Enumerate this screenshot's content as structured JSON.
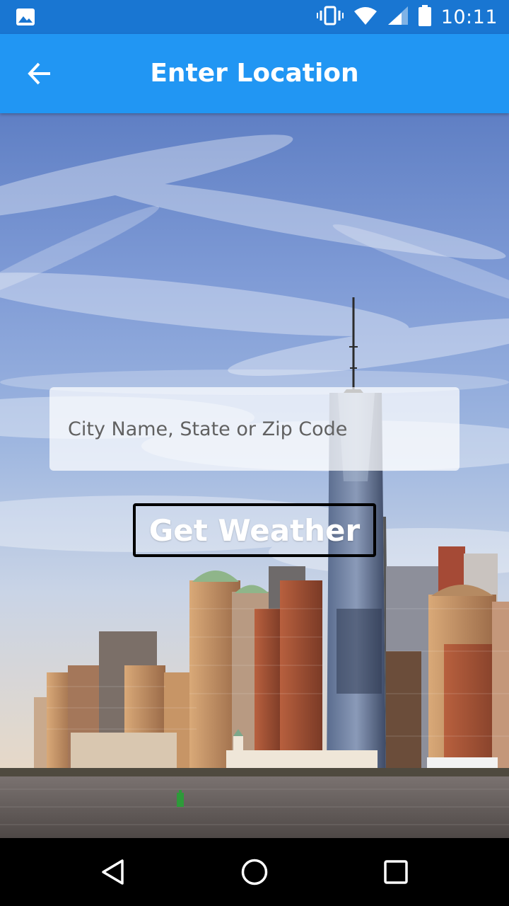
{
  "status_bar": {
    "time": "10:11",
    "icons": [
      "image-notification-icon",
      "vibrate-icon",
      "wifi-icon",
      "cell-signal-icon",
      "battery-icon"
    ]
  },
  "app_bar": {
    "title": "Enter Location",
    "back_icon": "arrow-back-icon",
    "background": "#2196f3",
    "status_background": "#1976d2"
  },
  "search": {
    "placeholder": "City Name, State or Zip Code",
    "value": ""
  },
  "actions": {
    "get_weather_label": "Get Weather"
  },
  "nav_bar": {
    "icons": [
      "back-triangle-icon",
      "home-circle-icon",
      "recents-square-icon"
    ]
  }
}
